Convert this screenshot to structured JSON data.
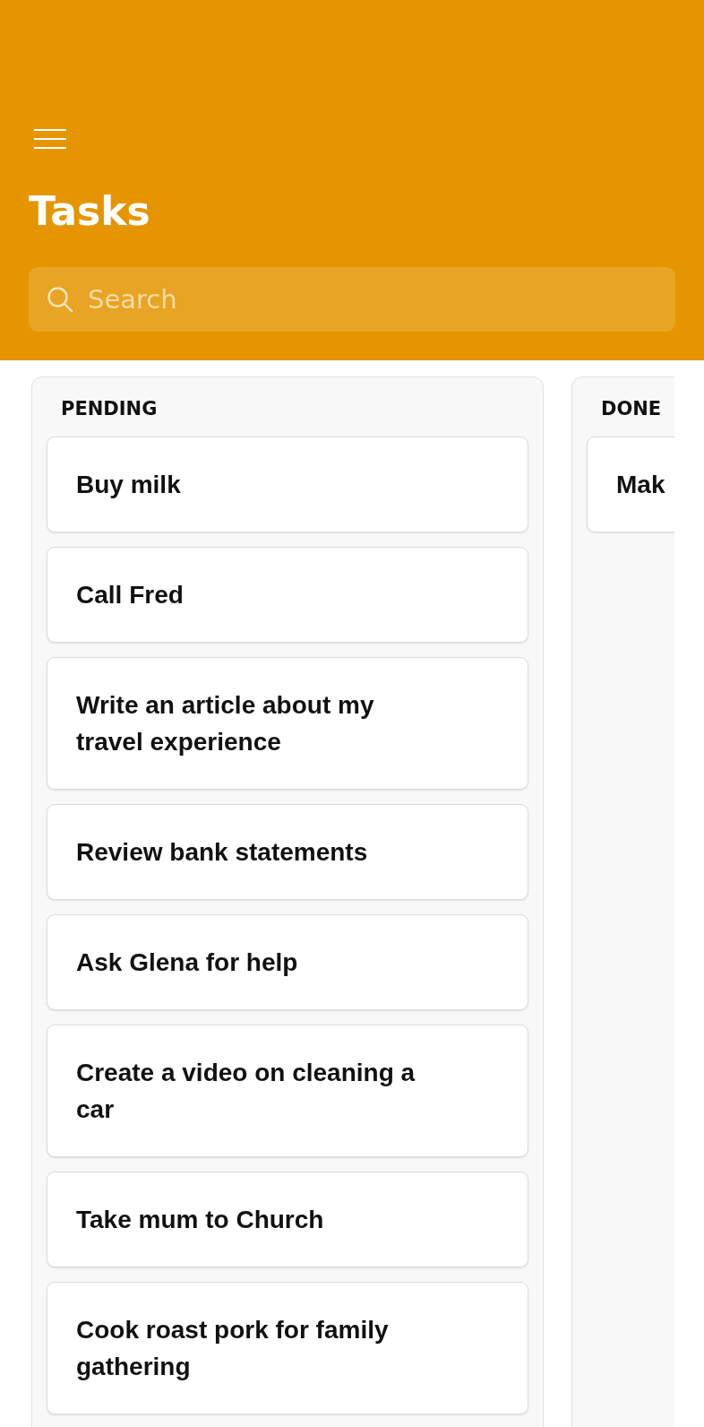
{
  "header": {
    "title": "Tasks"
  },
  "search": {
    "placeholder": "Search"
  },
  "columns": [
    {
      "title": "PENDING",
      "cards": [
        {
          "text": "Buy milk"
        },
        {
          "text": "Call Fred"
        },
        {
          "text": "Write an article about my travel experience"
        },
        {
          "text": "Review bank statements"
        },
        {
          "text": "Ask Glena for help"
        },
        {
          "text": "Create a video on cleaning a car"
        },
        {
          "text": "Take mum to Church"
        },
        {
          "text": "Cook roast pork for family gathering"
        }
      ]
    },
    {
      "title": "DONE",
      "cards": [
        {
          "text": "Mak"
        }
      ]
    }
  ]
}
